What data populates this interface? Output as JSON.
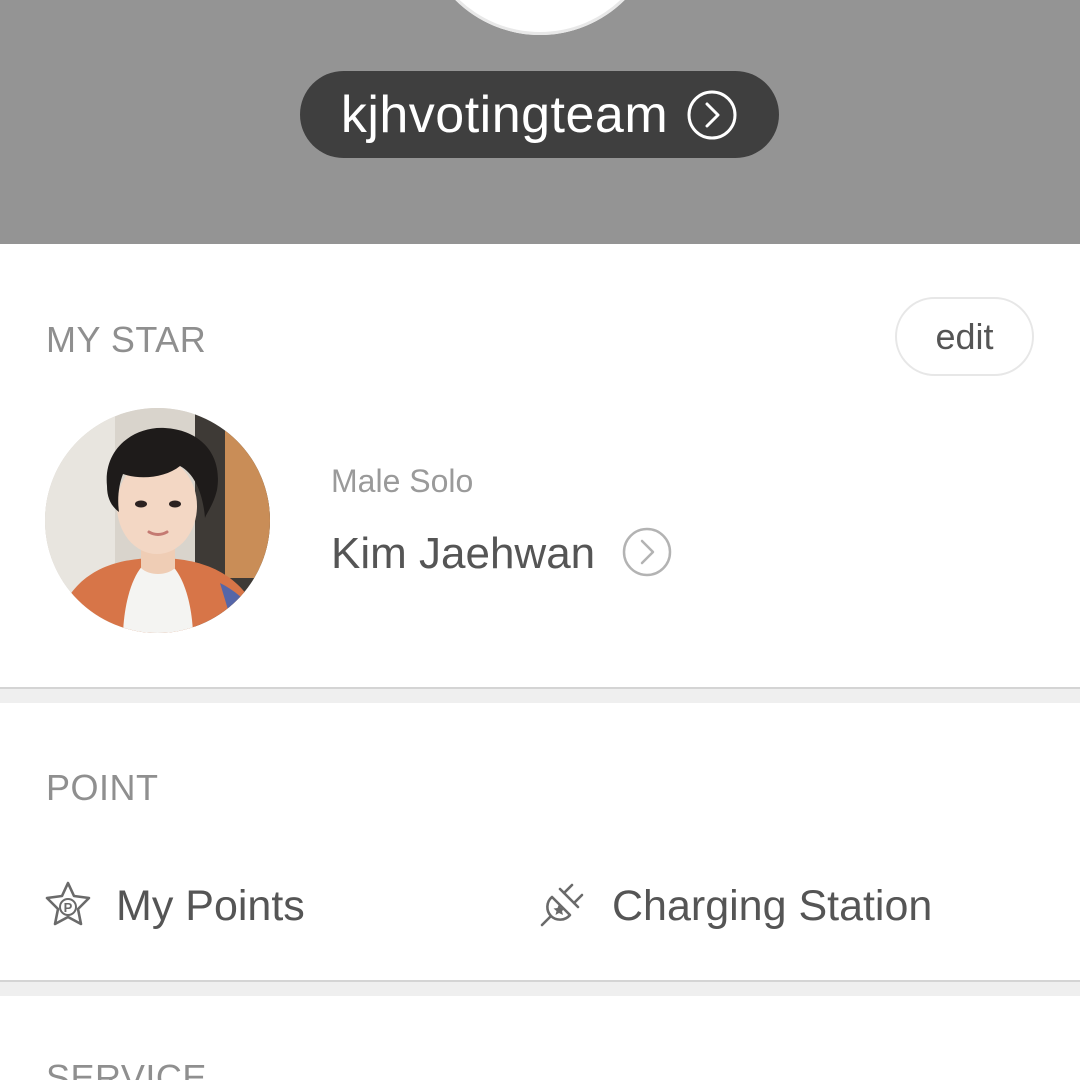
{
  "header": {
    "username": "kjhvotingteam",
    "background_color": "#949494",
    "pill_color": "#3f3f3f"
  },
  "my_star": {
    "section_title": "MY STAR",
    "edit_label": "edit",
    "star": {
      "category": "Male Solo",
      "name": "Kim Jaehwan"
    }
  },
  "point": {
    "section_title": "POINT",
    "items": [
      {
        "label": "My Points",
        "icon": "star-p-icon"
      },
      {
        "label": "Charging Station",
        "icon": "plug-star-icon"
      }
    ]
  },
  "service": {
    "section_title": "SERVICE"
  }
}
